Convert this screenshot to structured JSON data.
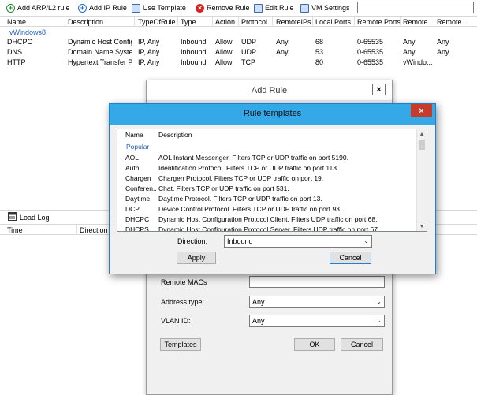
{
  "toolbar": {
    "add_arp_label": "Add ARP/L2 rule",
    "add_ip_label": "Add IP Rule",
    "use_template_label": "Use Template",
    "remove_rule_label": "Remove Rule",
    "edit_rule_label": "Edit Rule",
    "vm_settings_label": "VM Settings",
    "search_value": ""
  },
  "grid": {
    "columns": [
      "Name",
      "Description",
      "TypeOfRule",
      "Type",
      "Action",
      "Protocol",
      "RemoteIPs",
      "Local Ports",
      "Remote Ports",
      "Remote...",
      "Remote..."
    ],
    "group": "vWindows8",
    "rows": [
      [
        "DHCPC",
        "Dynamic Host Config...",
        "IP, Any",
        "Inbound",
        "Allow",
        "UDP",
        "Any",
        "68",
        "0-65535",
        "Any",
        "Any"
      ],
      [
        "DNS",
        "Domain Name Syste...",
        "IP, Any",
        "Inbound",
        "Allow",
        "UDP",
        "Any",
        "53",
        "0-65535",
        "Any",
        "Any"
      ],
      [
        "HTTP",
        "Hypertext Transfer Pr...",
        "IP, Any",
        "Inbound",
        "Allow",
        "TCP",
        "",
        "80",
        "0-65535",
        "vWindo...",
        ""
      ]
    ]
  },
  "log": {
    "load_label": "Load Log",
    "columns": [
      "Time",
      "Direction"
    ]
  },
  "add_rule": {
    "title": "Add Rule",
    "remote_macs_label": "Remote MACs",
    "remote_macs_value": "",
    "address_type_label": "Address type:",
    "address_type_value": "Any",
    "vlan_label": "VLAN ID:",
    "vlan_value": "Any",
    "templates_label": "Templates",
    "ok_label": "OK",
    "cancel_label": "Cancel"
  },
  "rule_templates": {
    "title": "Rule templates",
    "col_name": "Name",
    "col_description": "Description",
    "group": "Popular",
    "rows": [
      {
        "name": "AOL",
        "description": "AOL Instant Messenger. Filters TCP or UDP traffic on port 5190."
      },
      {
        "name": "Auth",
        "description": "Identification Protocol. Filters TCP or UDP traffic on port 113."
      },
      {
        "name": "Chargen",
        "description": "Chargen Protocol. Filters TCP or UDP traffic on port 19."
      },
      {
        "name": "Conferen...",
        "description": "Chat. Filters TCP or UDP traffic on port 531."
      },
      {
        "name": "Daytime",
        "description": "Daytime Protocol. Filters TCP or UDP traffic on port 13."
      },
      {
        "name": "DCP",
        "description": "Device Control Protocol. Filters TCP or UDP traffic on port 93."
      },
      {
        "name": "DHCPC",
        "description": "Dynamic Host Configuration Protocol Client. Filters UDP traffic on port 68."
      },
      {
        "name": "DHCPS",
        "description": "Dynamic Host Configuration Protocol Server. Filters UDP traffic on port 67."
      }
    ],
    "direction_label": "Direction:",
    "direction_value": "Inbound",
    "apply_label": "Apply",
    "cancel_label": "Cancel"
  }
}
